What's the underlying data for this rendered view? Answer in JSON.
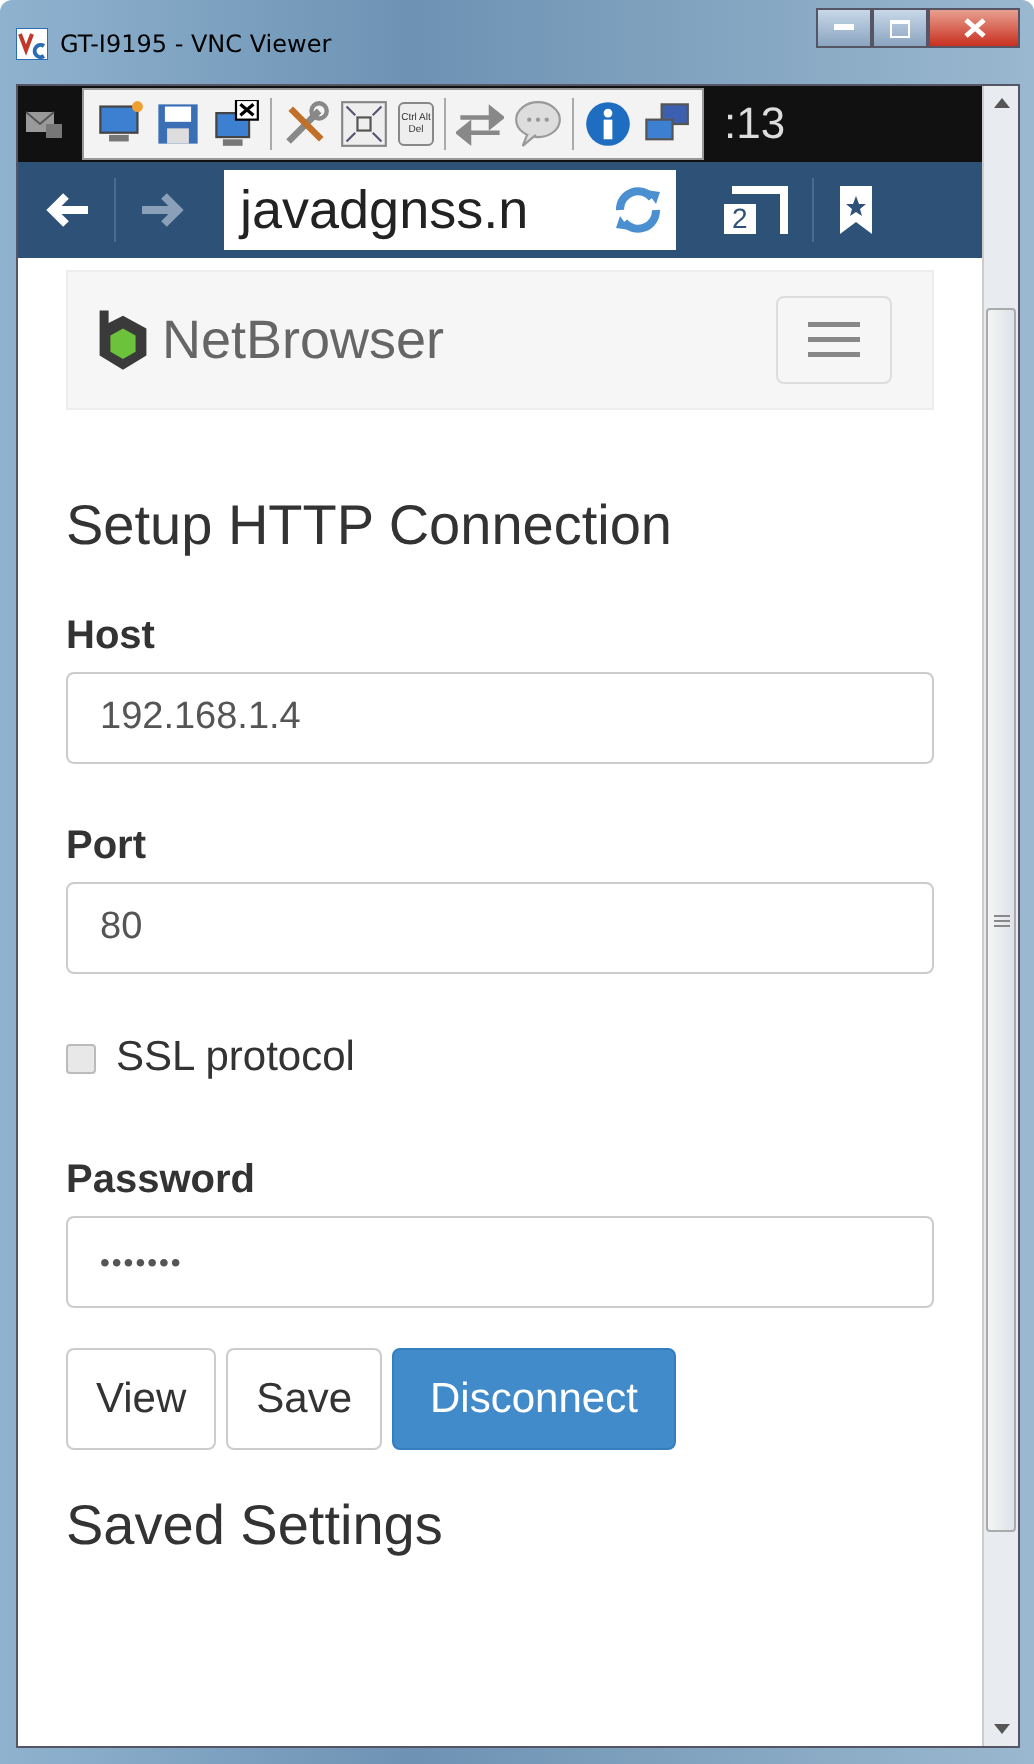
{
  "window": {
    "title": "GT-I9195 - VNC Viewer"
  },
  "vnc_toolbar": {
    "clock": ":13",
    "ctrl_alt_del": "Ctrl Alt Del"
  },
  "browser_bar": {
    "url": "javadgnss.n",
    "tab_count": "2"
  },
  "navbar": {
    "brand": "NetBrowser"
  },
  "form": {
    "heading": "Setup HTTP Connection",
    "fields": [
      {
        "kind": "text",
        "label": "Host",
        "value": "192.168.1.4"
      },
      {
        "kind": "text",
        "label": "Port",
        "value": "80"
      },
      {
        "kind": "checkbox",
        "label": "SSL protocol",
        "checked": false
      },
      {
        "kind": "password",
        "label": "Password",
        "value": "•••••••"
      }
    ],
    "buttons": [
      {
        "label": "View",
        "primary": false
      },
      {
        "label": "Save",
        "primary": false
      },
      {
        "label": "Disconnect",
        "primary": true
      }
    ]
  },
  "saved_heading": "Saved Settings"
}
